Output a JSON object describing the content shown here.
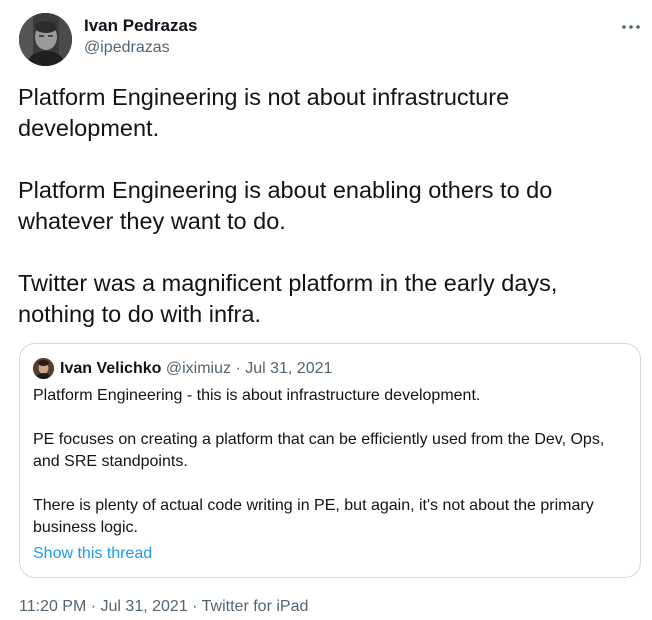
{
  "tweet": {
    "author": {
      "name": "Ivan Pedrazas",
      "handle": "@ipedrazas"
    },
    "more_icon": "ellipsis-icon",
    "paragraphs": [
      "Platform Engineering is not about infrastructure development.",
      "Platform Engineering is about enabling others to do whatever they want to do.",
      "Twitter was a magnificent platform in the early days, nothing to do with infra."
    ],
    "timestamp_time": "11:20 PM",
    "timestamp_date": "Jul 31, 2021",
    "source": "Twitter for iPad",
    "separator": "·"
  },
  "quote": {
    "author_name": "Ivan Velichko",
    "author_handle": "@iximiuz",
    "date": "Jul 31, 2021",
    "separator": "·",
    "paragraphs": [
      "Platform Engineering - this is about infrastructure development.",
      "PE focuses on creating a platform that can be efficiently used from the Dev, Ops, and SRE standpoints.",
      "There is plenty of actual code writing in PE, but again, it's not about the primary business logic."
    ],
    "show_thread_label": "Show this thread"
  },
  "colors": {
    "text": "#0f1419",
    "secondary": "#536471",
    "link": "#1d9bf0",
    "border": "#cfd9de"
  }
}
